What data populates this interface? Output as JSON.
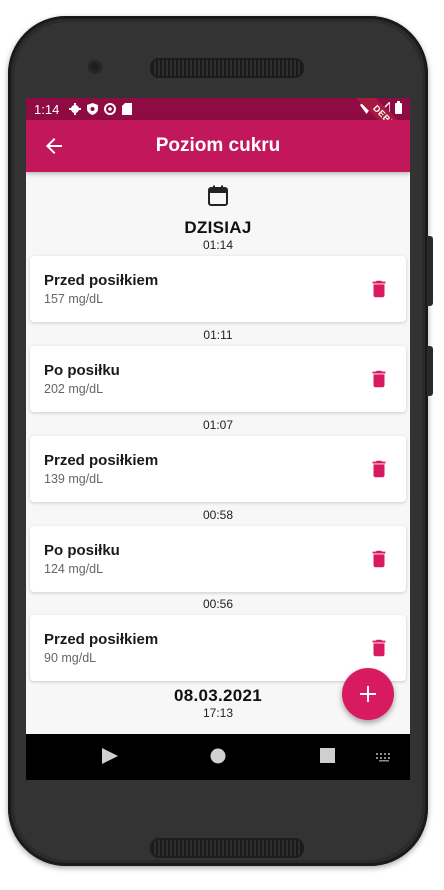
{
  "status_bar": {
    "time": "1:14",
    "icons_left": [
      "gear-icon",
      "shield-icon",
      "at-icon",
      "sd-card-icon"
    ],
    "icons_right": [
      "wifi-icon",
      "signal-icon",
      "battery-icon"
    ],
    "debug_banner": "DEBUG"
  },
  "app_bar": {
    "title": "Poziom cukru",
    "back_icon": "arrow-left-icon"
  },
  "colors": {
    "primary": "#c2185b",
    "primary_dark": "#8e0c43",
    "accent": "#d81b60",
    "background": "#f7f7f7"
  },
  "groups": [
    {
      "date": "DZISIAJ",
      "entries": [
        {
          "time": "01:14",
          "type": "Przed posiłkiem",
          "value": "157 mg/dL"
        },
        {
          "time": "01:11",
          "type": "Po posiłku",
          "value": "202 mg/dL"
        },
        {
          "time": "01:07",
          "type": "Przed posiłkiem",
          "value": "139 mg/dL"
        },
        {
          "time": "00:58",
          "type": "Po posiłku",
          "value": "124 mg/dL"
        },
        {
          "time": "00:56",
          "type": "Przed posiłkiem",
          "value": "90 mg/dL"
        }
      ]
    },
    {
      "date": "08.03.2021",
      "entries": [
        {
          "time": "17:13"
        }
      ]
    }
  ],
  "fab": {
    "icon": "plus-icon"
  },
  "nav_bar": {
    "icons": [
      "back-triangle-icon",
      "home-circle-icon",
      "recents-square-icon",
      "keyboard-icon"
    ]
  }
}
